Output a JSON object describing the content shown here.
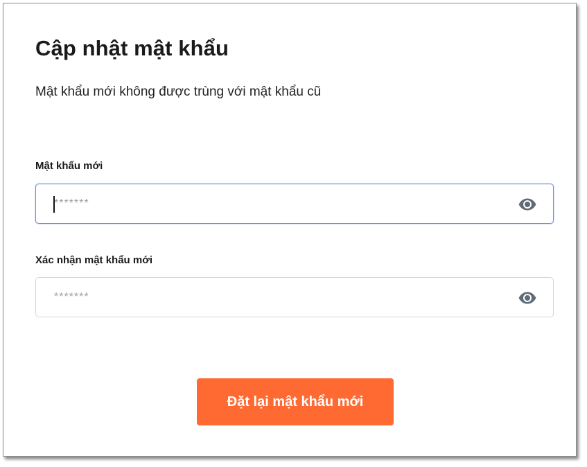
{
  "page": {
    "title": "Cập nhật mật khẩu",
    "subtitle": "Mật khẩu mới không được trùng với mật khẩu cũ"
  },
  "fields": {
    "new_password": {
      "label": "Mật khẩu mới",
      "value": "",
      "placeholder": "*******",
      "toggle_icon": "eye-icon",
      "focused": true
    },
    "confirm_password": {
      "label": "Xác nhận mật khẩu mới",
      "value": "",
      "placeholder": "*******",
      "toggle_icon": "eye-icon",
      "focused": false
    }
  },
  "submit": {
    "label": "Đặt lại mật khẩu mới"
  },
  "colors": {
    "accent": "#ff6a33",
    "focus_border": "#6b8fe0",
    "icon": "#5f6b76"
  }
}
